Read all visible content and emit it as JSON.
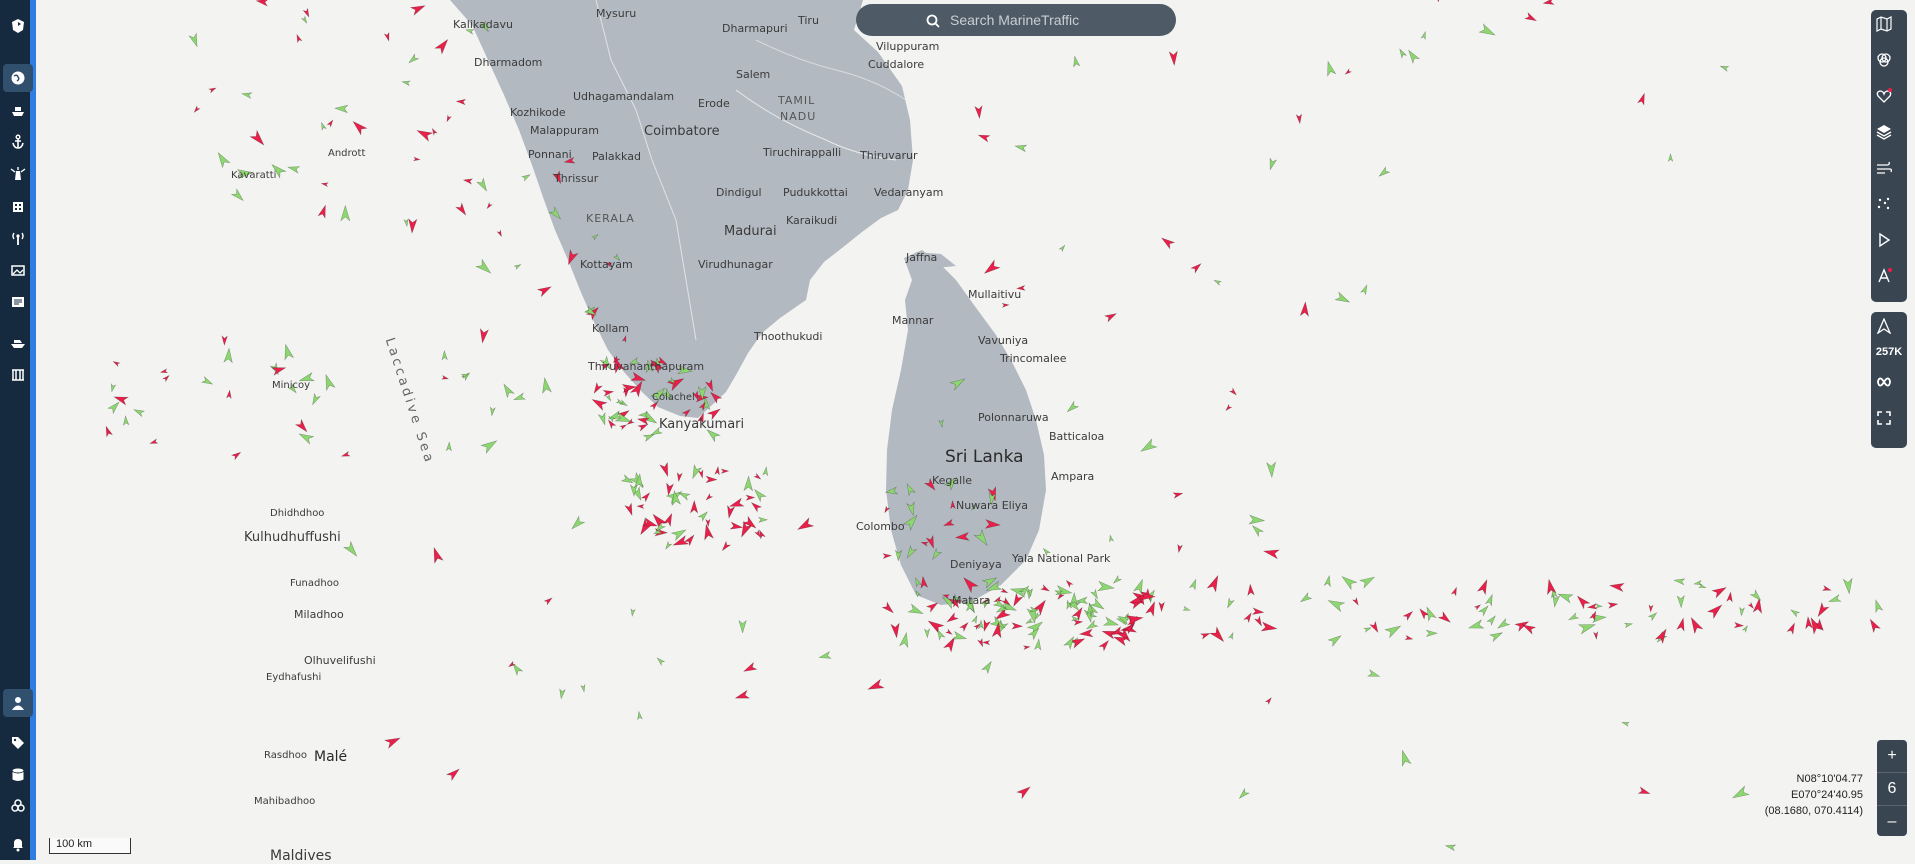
{
  "search": {
    "placeholder": "Search MarineTraffic"
  },
  "icons": {
    "sidebar": [
      "logo-icon",
      "globe-icon",
      "ship-icon",
      "anchor-icon",
      "lighthouse-icon",
      "building-icon",
      "antenna-icon",
      "gallery-icon",
      "news-icon",
      "vessel-icon",
      "port-icon",
      "user-icon",
      "tag-icon",
      "database-icon",
      "fleet-icon",
      "bell-icon"
    ],
    "rightbar": [
      "map-icon",
      "filter-icon",
      "favorites-icon",
      "layers-icon",
      "weather-icon",
      "density-icon",
      "play-icon",
      "ai-icon"
    ]
  },
  "rightbar": {
    "count": "257K"
  },
  "zoom": {
    "plus": "+",
    "level": "6",
    "minus": "–"
  },
  "coords": {
    "lat": "N08°10'04.77",
    "lon": "E070°24'40.95",
    "decimal": "(08.1680, 070.4114)"
  },
  "scale": {
    "label": "100 km"
  },
  "colors": {
    "sidebar": "#152a3f",
    "land": "#b2b9c0",
    "sea": "#f3f3f2",
    "cargo": "#e9204a",
    "tanker": "#8cd76f",
    "accent": "#2f7de1"
  },
  "labels": {
    "kalikadavu": "Kalikadavu",
    "mysuru": "Mysuru",
    "dharmapuri": "Dharmapuri",
    "tiru": "Tiru",
    "viluppuram": "Viluppuram",
    "cuddalore": "Cuddalore",
    "dharmadom": "Dharmadom",
    "salem": "Salem",
    "udhagamandalam": "Udhagamandalam",
    "erode": "Erode",
    "tamil": "TAMIL",
    "nadu": "NADU",
    "kozhikode": "Kozhikode",
    "malappuram": "Malappuram",
    "coimbatore": "Coimbatore",
    "andrott": "Andrott",
    "ponnani": "Ponnani",
    "palakkad": "Palakkad",
    "tiruchirappalli": "Tiruchirappalli",
    "thiruvarur": "Thiruvarur",
    "kavaratti": "Kavaratti",
    "thrissur": "Thrissur",
    "dindigul": "Dindigul",
    "pudukkottai": "Pudukkottai",
    "vedaranyam": "Vedaranyam",
    "kerala": "KERALA",
    "karaikudi": "Karaikudi",
    "madurai": "Madurai",
    "jaffna": "Jaffna",
    "kottayam": "Kottayam",
    "virudhunagar": "Virudhunagar",
    "mullaitivu": "Mullaitivu",
    "mannar": "Mannar",
    "vavuniya": "Vavuniya",
    "kollam": "Kollam",
    "thoothukudi": "Thoothukudi",
    "laccadive_sea": "Laccadive Sea",
    "trincomalee": "Trincomalee",
    "thiruvananthapuram": "Thiruvananthapuram",
    "minicoy": "Minicoy",
    "colachel": "Colachel",
    "kanyakumari": "Kanyakumari",
    "polonnaruwa": "Polonnaruwa",
    "sri_lanka": "Sri Lanka",
    "batticaloa": "Batticaloa",
    "kegalle": "Kegalle",
    "ampara": "Ampara",
    "nuwara_eliya": "Nuwara Eliya",
    "dhidhdhoo": "Dhidhdhoo",
    "colombo": "Colombo",
    "kulhudhuffushi": "Kulhudhuffushi",
    "deniyaya": "Deniyaya",
    "yala": "Yala National Park",
    "funadhoo": "Funadhoo",
    "matara": "Matara",
    "miladhoo": "Miladhoo",
    "olhuvelifushi": "Olhuvelifushi",
    "eydhafushi": "Eydhafushi",
    "rasdhoo": "Rasdhoo",
    "male": "Malé",
    "mahibadhoo": "Mahibadhoo",
    "maldives": "Maldives"
  }
}
